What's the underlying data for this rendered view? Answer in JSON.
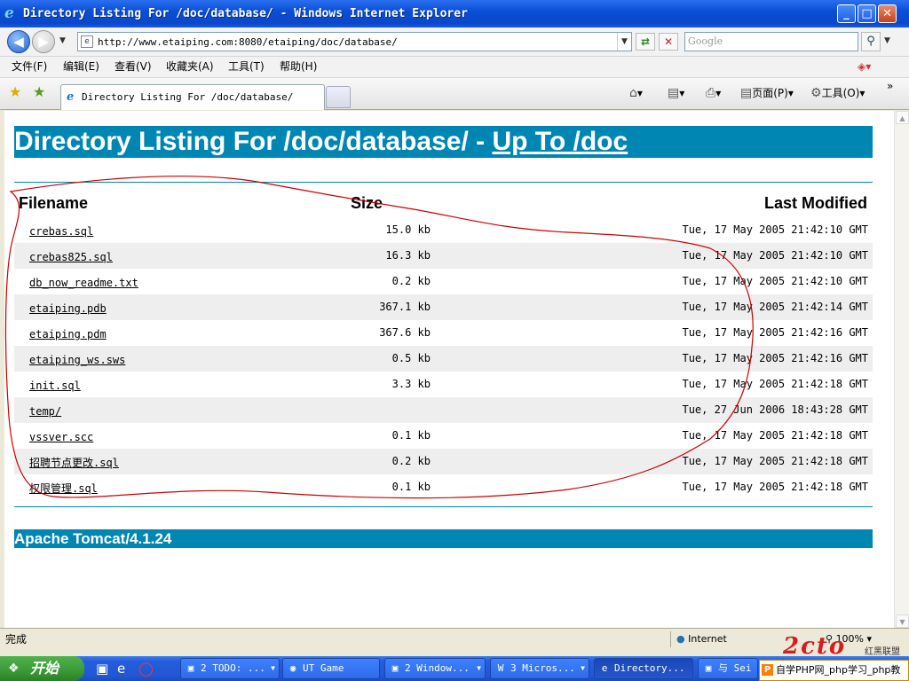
{
  "window": {
    "title": "Directory Listing For /doc/database/ - Windows Internet Explorer",
    "min_label": "_",
    "max_label": "□",
    "close_label": "✕"
  },
  "addressbar": {
    "url": "http://www.etaiping.com:8080/etaiping/doc/database/",
    "search_placeholder": "Google"
  },
  "menu": [
    "文件(F)",
    "编辑(E)",
    "查看(V)",
    "收藏夹(A)",
    "工具(T)",
    "帮助(H)"
  ],
  "tab": {
    "label": "Directory Listing For /doc/database/"
  },
  "commandbar": {
    "page_label": "页面(P)",
    "tools_label": "工具(O)"
  },
  "page": {
    "heading_prefix": "Directory Listing For /doc/database/ - ",
    "heading_link": "Up To /doc",
    "columns": {
      "name": "Filename",
      "size": "Size",
      "modified": "Last Modified"
    },
    "files": [
      {
        "name": "crebas.sql",
        "size": "15.0 kb",
        "modified": "Tue, 17 May 2005 21:42:10 GMT"
      },
      {
        "name": "crebas825.sql",
        "size": "16.3 kb",
        "modified": "Tue, 17 May 2005 21:42:10 GMT"
      },
      {
        "name": "db_now_readme.txt",
        "size": "0.2 kb",
        "modified": "Tue, 17 May 2005 21:42:10 GMT"
      },
      {
        "name": "etaiping.pdb",
        "size": "367.1 kb",
        "modified": "Tue, 17 May 2005 21:42:14 GMT"
      },
      {
        "name": "etaiping.pdm",
        "size": "367.6 kb",
        "modified": "Tue, 17 May 2005 21:42:16 GMT"
      },
      {
        "name": "etaiping_ws.sws",
        "size": "0.5 kb",
        "modified": "Tue, 17 May 2005 21:42:16 GMT"
      },
      {
        "name": "init.sql",
        "size": "3.3 kb",
        "modified": "Tue, 17 May 2005 21:42:18 GMT"
      },
      {
        "name": "temp/",
        "size": "",
        "modified": "Tue, 27 Jun 2006 18:43:28 GMT"
      },
      {
        "name": "vssver.scc",
        "size": "0.1 kb",
        "modified": "Tue, 17 May 2005 21:42:18 GMT"
      },
      {
        "name": "招聘节点更改.sql",
        "size": "0.2 kb",
        "modified": "Tue, 17 May 2005 21:42:18 GMT"
      },
      {
        "name": "权限管理.sql",
        "size": "0.1 kb",
        "modified": "Tue, 17 May 2005 21:42:18 GMT"
      }
    ],
    "footer": "Apache Tomcat/4.1.24"
  },
  "statusbar": {
    "text": "完成",
    "zone": "Internet",
    "zoom": "100%"
  },
  "taskbar": {
    "start_label": "开始",
    "items": [
      "2 TODO: ...",
      "UT Game",
      "2 Window...",
      "3 Micros...",
      "Directory...",
      "与 Sei"
    ]
  },
  "watermark": {
    "text": "自学PHP网_php学习_php教",
    "logo_caption": "红黑联盟"
  },
  "colors": {
    "accent": "#0086b2",
    "title_bar": "#0a4fd6",
    "taskbar": "#245edc",
    "annotation": "#cc0000"
  }
}
